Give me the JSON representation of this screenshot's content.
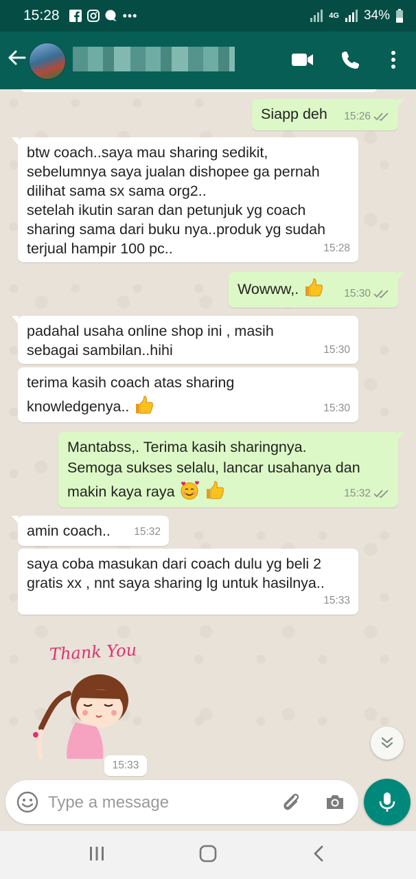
{
  "status_bar": {
    "time": "15:28",
    "network": "4G",
    "battery": "34%",
    "more": "•••"
  },
  "header": {
    "contact_name": "",
    "icons": [
      "back-arrow-icon",
      "video-call-icon",
      "phone-icon",
      "more-vert-icon"
    ]
  },
  "messages": [
    {
      "dir": "out",
      "text": "Siapp deh",
      "time": "15:26",
      "ticks": true
    },
    {
      "dir": "in",
      "lines": [
        "btw coach..saya mau sharing sedikit,",
        "sebelumnya saya jualan dishopee ga pernah",
        "dilihat sama sx sama org2..",
        "setelah ikutin saran dan petunjuk yg coach",
        "sharing sama dari buku nya..produk yg sudah",
        "terjual  hampir 100 pc.."
      ],
      "time": "15:28"
    },
    {
      "dir": "out",
      "text": "Wowww,.",
      "time": "15:30",
      "ticks": true
    },
    {
      "dir": "in",
      "lines": [
        "padahal usaha online shop ini , masih",
        "sebagai sambilan..hihi"
      ],
      "time": "15:30"
    },
    {
      "dir": "in",
      "lines": [
        "terima kasih coach atas sharing",
        "knowledgenya.."
      ],
      "time": "15:30"
    },
    {
      "dir": "out",
      "lines": [
        "Mantabss,. Terima kasih sharingnya.",
        "Semoga sukses selalu, lancar usahanya dan",
        "makin kaya raya"
      ],
      "time": "15:32",
      "ticks": true
    },
    {
      "dir": "in",
      "text": "amin coach..",
      "time": "15:32"
    },
    {
      "dir": "in",
      "lines": [
        "saya coba masukan dari coach dulu yg beli 2",
        "gratis xx , nnt saya sharing lg untuk hasilnya.."
      ],
      "time": "15:33"
    }
  ],
  "sticker": {
    "caption": "Thank You",
    "time": "15:33"
  },
  "composer": {
    "placeholder": "Type a message"
  },
  "colors": {
    "header": "#075e54",
    "status_bar": "#054d44",
    "outgoing_bubble": "#dcf8c6",
    "incoming_bubble": "#ffffff",
    "chat_background": "#e9e2d9",
    "mic_button": "#00897b"
  }
}
